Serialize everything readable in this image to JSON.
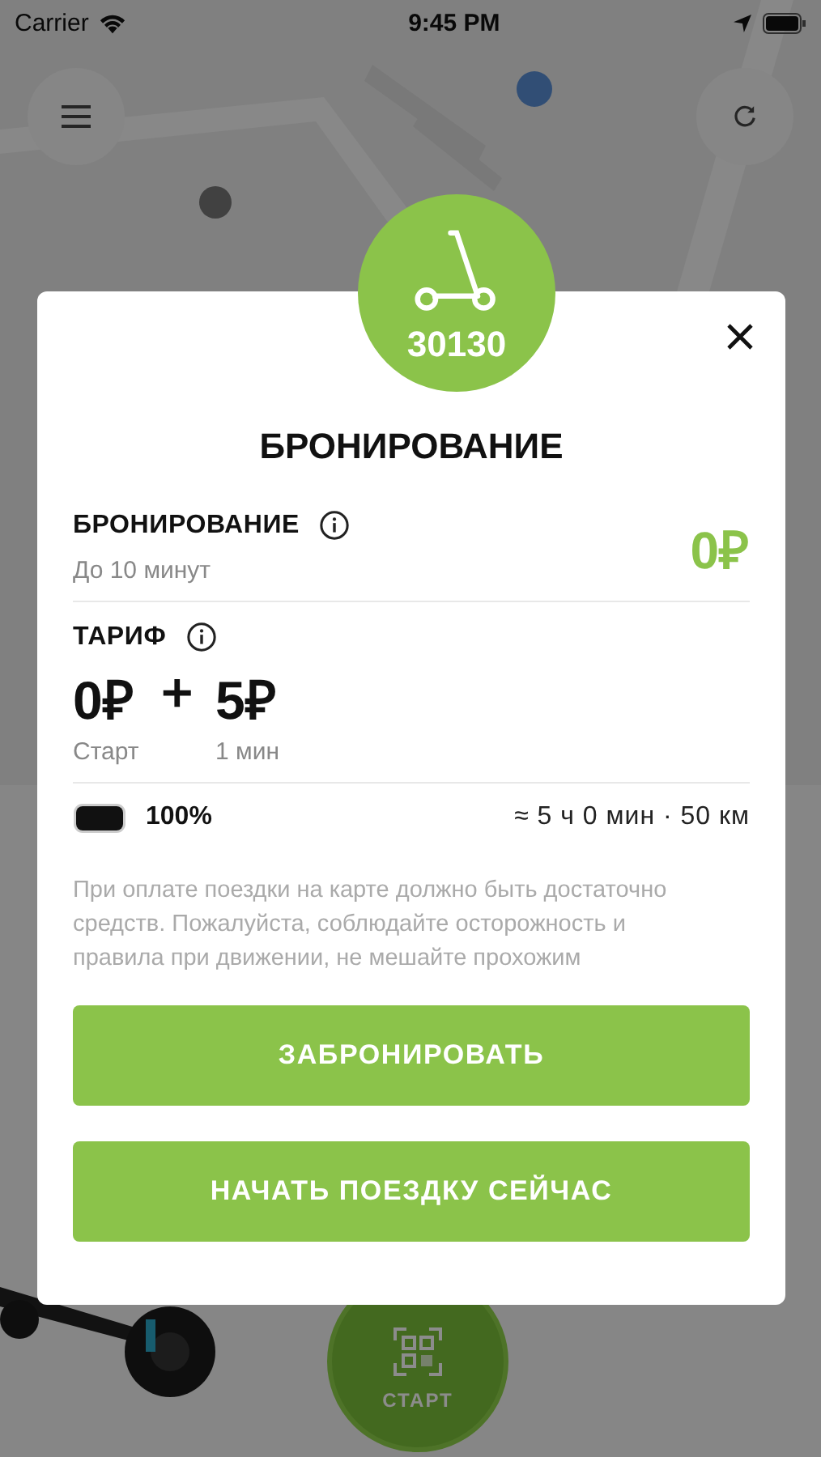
{
  "status_bar": {
    "carrier": "Carrier",
    "time": "9:45 PM"
  },
  "bottom_sheet": {
    "start_button": {
      "label": "СТАРТ"
    }
  },
  "modal": {
    "scooter_number": "30130",
    "title": "БРОНИРОВАНИЕ",
    "booking": {
      "label": "БРОНИРОВАНИЕ",
      "note": "До 10 минут",
      "price": "0₽"
    },
    "tariff": {
      "label": "ТАРИФ",
      "start_price": "0₽",
      "plus": "+",
      "minute_price": "5₽",
      "start_label": "Старт",
      "minute_label": "1 мин"
    },
    "battery": {
      "level": 1,
      "percent": "100%",
      "range": "≈ 5 ч 0 мин · 50 км"
    },
    "disclaimer": "При оплате поездки на карте должно быть достаточно средств. Пожалуйста, соблюдайте осторожность и правила при движении, не мешайте прохожим",
    "buttons": [
      {
        "label": "ЗАБРОНИРОВАТЬ"
      },
      {
        "label": "НАЧАТЬ ПОЕЗДКУ СЕЙЧАС"
      }
    ]
  }
}
